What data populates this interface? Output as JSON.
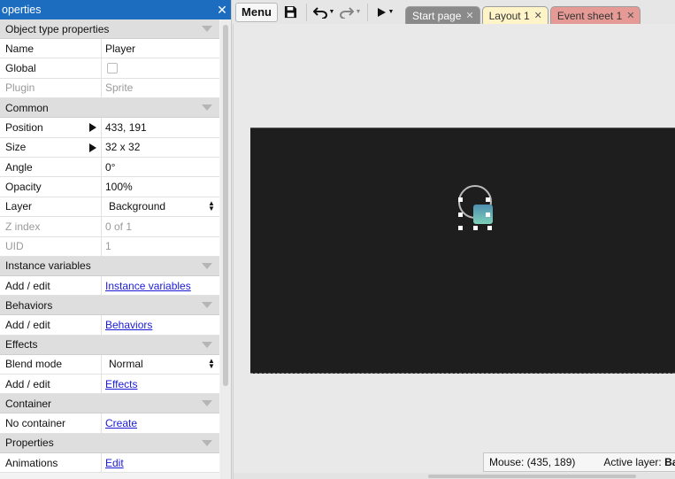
{
  "panel": {
    "title": "operties",
    "close_glyph": "✕",
    "sections": {
      "object_type": "Object type properties",
      "common": "Common",
      "instance_vars": "Instance variables",
      "behaviors": "Behaviors",
      "effects": "Effects",
      "container": "Container",
      "properties": "Properties"
    },
    "rows": {
      "name": {
        "key": "Name",
        "value": "Player"
      },
      "global": {
        "key": "Global",
        "checked": false
      },
      "plugin": {
        "key": "Plugin",
        "value": "Sprite"
      },
      "position": {
        "key": "Position",
        "value": "433, 191"
      },
      "size": {
        "key": "Size",
        "value": "32 x 32"
      },
      "angle": {
        "key": "Angle",
        "value": "0°"
      },
      "opacity": {
        "key": "Opacity",
        "value": "100%"
      },
      "layer": {
        "key": "Layer",
        "value": "Background"
      },
      "zindex": {
        "key": "Z index",
        "value": "0 of 1"
      },
      "uid": {
        "key": "UID",
        "value": "1"
      },
      "inst_vars": {
        "key": "Add / edit",
        "link": "Instance variables"
      },
      "behaviors": {
        "key": "Add / edit",
        "link": "Behaviors"
      },
      "blend": {
        "key": "Blend mode",
        "value": "Normal"
      },
      "effects": {
        "key": "Add / edit",
        "link": "Effects"
      },
      "container": {
        "key": "No container",
        "link": "Create"
      },
      "animations": {
        "key": "Animations",
        "link": "Edit"
      }
    }
  },
  "toolbar": {
    "menu_label": "Menu",
    "save_icon": "save-icon",
    "undo_icon": "undo-icon",
    "redo_icon": "redo-icon",
    "play_icon": "play-icon"
  },
  "tabs": [
    {
      "label": "Start page",
      "close": "✕"
    },
    {
      "label": "Layout 1",
      "close": "✕"
    },
    {
      "label": "Event sheet 1",
      "close": "✕"
    }
  ],
  "status": {
    "mouse": "Mouse: (435, 189)",
    "active_layer_label": "Active layer:",
    "active_layer_value": "Bac"
  },
  "colors": {
    "panel_title_bg": "#1c6dc0",
    "canvas_bg": "#1e1e1e",
    "tab_layout": "#fff4c7",
    "tab_events": "#e69a95",
    "tab_start": "#8a8a8a",
    "link": "#1a1ad6"
  }
}
